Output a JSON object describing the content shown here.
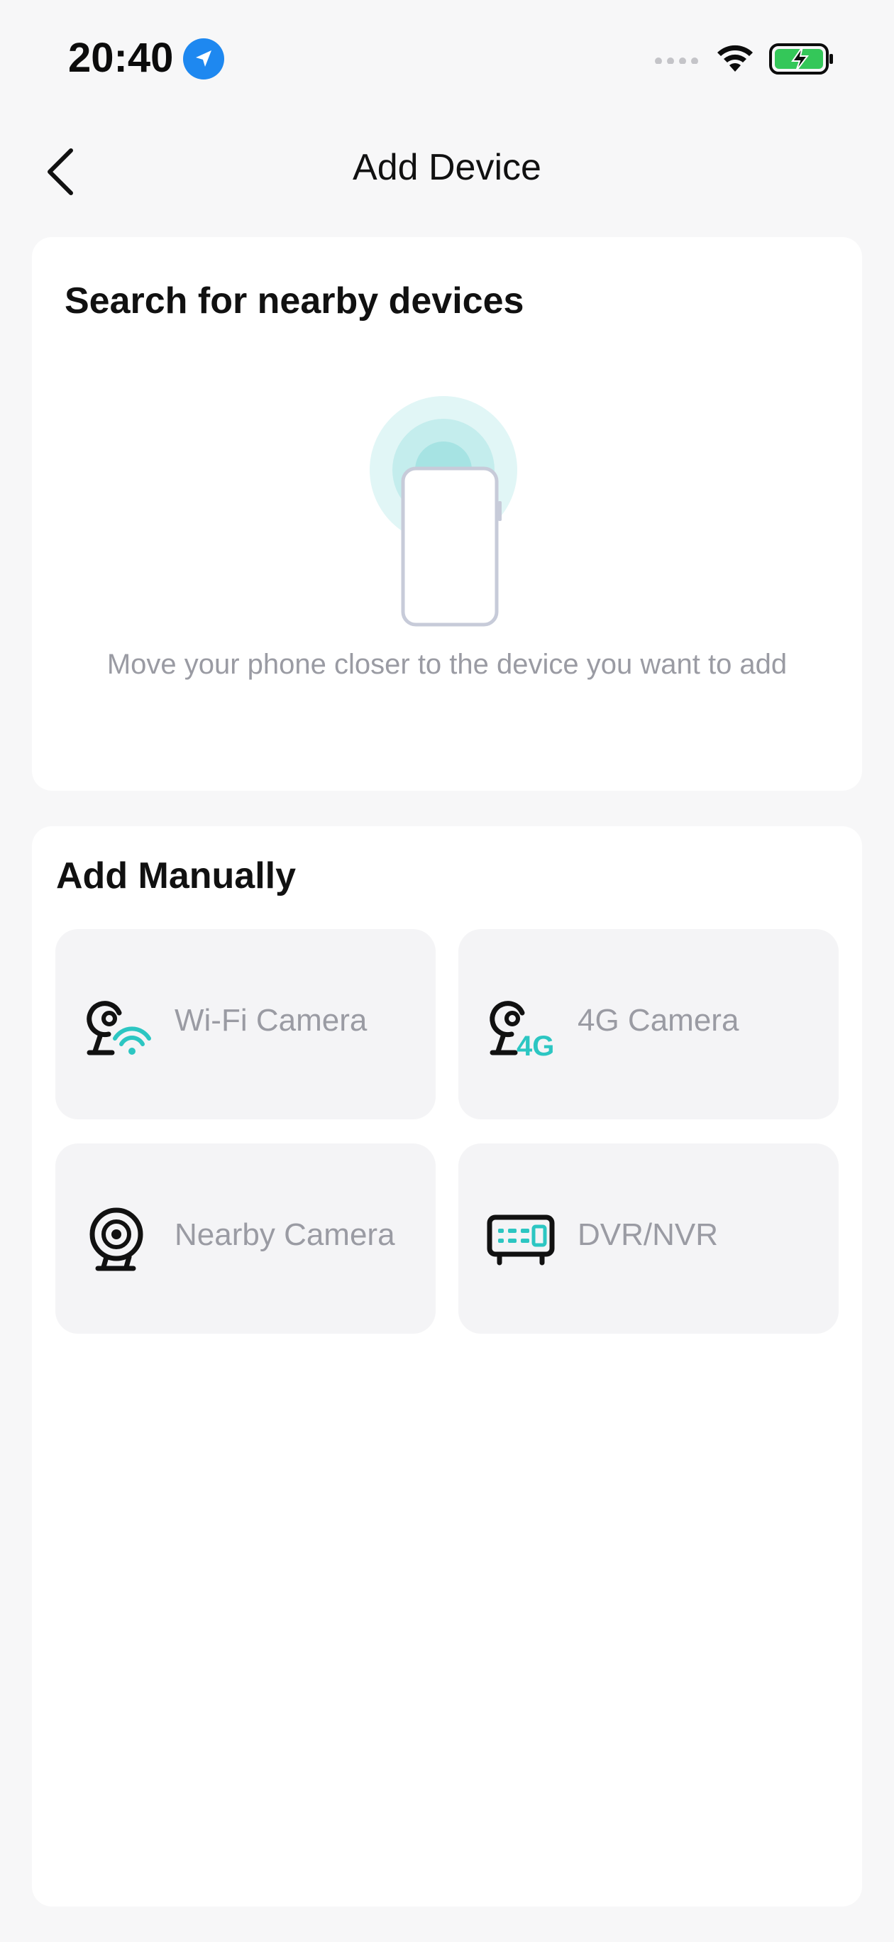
{
  "status_bar": {
    "time": "20:40",
    "icons": [
      "location-icon",
      "signal-dots-icon",
      "wifi-icon",
      "battery-charging-icon"
    ]
  },
  "nav": {
    "back_icon": "chevron-left-icon",
    "title": "Add Device"
  },
  "search_section": {
    "title": "Search for nearby devices",
    "hint": "Move your phone closer to the device you want to add"
  },
  "manual_section": {
    "title": "Add Manually",
    "items": [
      {
        "label": "Wi-Fi Camera",
        "icon": "wifi-camera-icon"
      },
      {
        "label": "4G Camera",
        "icon": "4g-camera-icon"
      },
      {
        "label": "Nearby Camera",
        "icon": "nearby-camera-icon"
      },
      {
        "label": "DVR/NVR",
        "icon": "dvr-nvr-icon"
      }
    ],
    "icon_badge_4g": "4G"
  },
  "colors": {
    "accent_teal": "#2cc6c2",
    "location_blue": "#1e88f0",
    "battery_green": "#34c759",
    "text_muted": "#9a9ba3"
  }
}
